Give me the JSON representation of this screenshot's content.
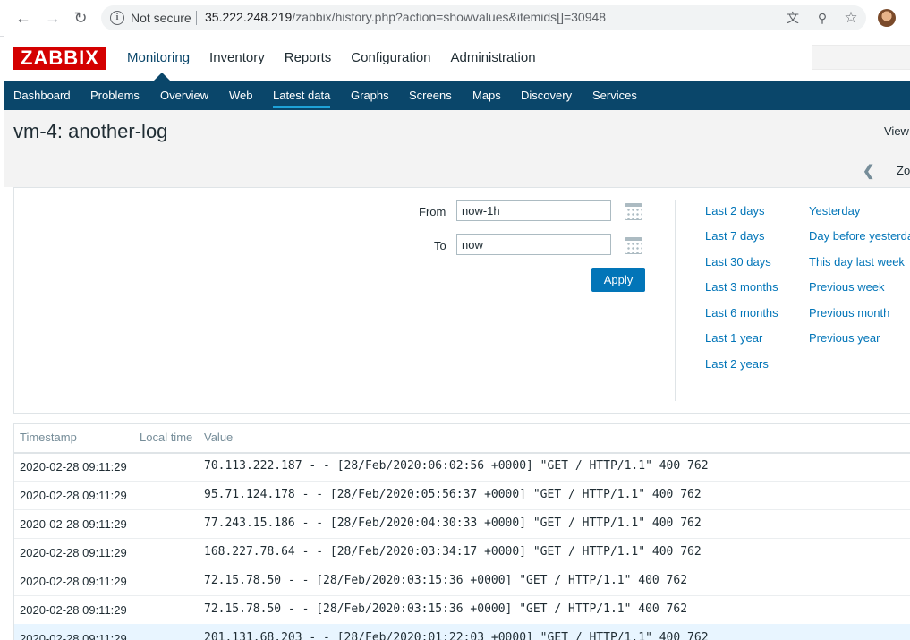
{
  "browser": {
    "security_label": "Not secure",
    "url_host": "35.222.248.219",
    "url_path": "/zabbix/history.php?action=showvalues&itemids[]=30948",
    "icons": [
      "back-icon",
      "forward-icon",
      "reload-icon",
      "info-icon",
      "translate-icon",
      "zoom-icon",
      "star-icon",
      "profile-avatar"
    ]
  },
  "header": {
    "logo": "ZABBIX",
    "menu": [
      "Monitoring",
      "Inventory",
      "Reports",
      "Configuration",
      "Administration"
    ],
    "active_menu": "Monitoring"
  },
  "submenu": {
    "items": [
      "Dashboard",
      "Problems",
      "Overview",
      "Web",
      "Latest data",
      "Graphs",
      "Screens",
      "Maps",
      "Discovery",
      "Services"
    ],
    "active": "Latest data"
  },
  "page": {
    "title": "vm-4: another-log",
    "view_label": "View",
    "zoom_label": "Zo"
  },
  "filter": {
    "from_label": "From",
    "from_value": "now-1h",
    "to_label": "To",
    "to_value": "now",
    "apply_label": "Apply",
    "quick_col1": [
      "Last 2 days",
      "Last 7 days",
      "Last 30 days",
      "Last 3 months",
      "Last 6 months",
      "Last 1 year",
      "Last 2 years"
    ],
    "quick_col2": [
      "Yesterday",
      "Day before yesterda",
      "This day last week",
      "Previous week",
      "Previous month",
      "Previous year"
    ]
  },
  "table": {
    "columns": [
      "Timestamp",
      "Local time",
      "Value"
    ],
    "rows": [
      {
        "timestamp": "2020-02-28 09:11:29",
        "local_time": "",
        "value": "70.113.222.187 - - [28/Feb/2020:06:02:56 +0000] \"GET / HTTP/1.1\" 400 762"
      },
      {
        "timestamp": "2020-02-28 09:11:29",
        "local_time": "",
        "value": "95.71.124.178 - - [28/Feb/2020:05:56:37 +0000] \"GET / HTTP/1.1\" 400 762"
      },
      {
        "timestamp": "2020-02-28 09:11:29",
        "local_time": "",
        "value": "77.243.15.186 - - [28/Feb/2020:04:30:33 +0000] \"GET / HTTP/1.1\" 400 762"
      },
      {
        "timestamp": "2020-02-28 09:11:29",
        "local_time": "",
        "value": "168.227.78.64 - - [28/Feb/2020:03:34:17 +0000] \"GET / HTTP/1.1\" 400 762"
      },
      {
        "timestamp": "2020-02-28 09:11:29",
        "local_time": "",
        "value": "72.15.78.50 - - [28/Feb/2020:03:15:36 +0000] \"GET / HTTP/1.1\" 400 762"
      },
      {
        "timestamp": "2020-02-28 09:11:29",
        "local_time": "",
        "value": "72.15.78.50 - - [28/Feb/2020:03:15:36 +0000] \"GET / HTTP/1.1\" 400 762"
      },
      {
        "timestamp": "2020-02-28 09:11:29",
        "local_time": "",
        "value": "201.131.68.203 - - [28/Feb/2020:01:22:03 +0000] \"GET / HTTP/1.1\" 400 762"
      }
    ]
  },
  "colors": {
    "brand_red": "#d40000",
    "nav_blue": "#0a466a",
    "link_blue": "#0275b8",
    "highlight_row": "#e8f5ff"
  }
}
